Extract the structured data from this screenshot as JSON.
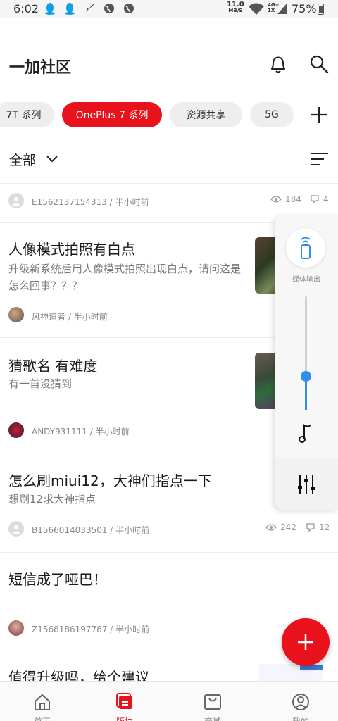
{
  "status_bar": {
    "time": "6:02",
    "net_speed_value": "11.0",
    "net_speed_unit": "MB/S",
    "net_type_top": "4G+",
    "net_type_bottom": "1X",
    "battery": "75%"
  },
  "header": {
    "title": "一加社区",
    "icons": [
      "bell-icon",
      "search-icon"
    ]
  },
  "tabs": [
    {
      "label": "7T 系列",
      "active": false
    },
    {
      "label": "OnePlus 7 系列",
      "active": true
    },
    {
      "label": "资源共享",
      "active": false
    },
    {
      "label": "5G",
      "active": false
    }
  ],
  "filter": {
    "label": "全部"
  },
  "posts": [
    {
      "title": "",
      "desc": "",
      "author": "E1562137154313",
      "time": "半小时前",
      "views": "184",
      "comments": "4"
    },
    {
      "title": "人像模式拍照有白点",
      "desc": "升级新系统后用人像模式拍照出现白点，请问这是怎么回事？？？",
      "author": "风神道者",
      "time": "半小时前"
    },
    {
      "title": "猜歌名 有难度",
      "desc": "有一首没猜到",
      "author": "ANDY931111",
      "time": "半小时前"
    },
    {
      "title": "怎么刷miui12，大神们指点一下",
      "desc": "想刷12求大神指点",
      "author": "B1566014033501",
      "time": "半小时前",
      "views": "242",
      "comments": "12"
    },
    {
      "title": "短信成了哑巴！",
      "desc": "",
      "author": "Z1568186197787",
      "time": "半小时前"
    },
    {
      "title": "值得升级吗，给个建议"
    }
  ],
  "meta_separator": " / ",
  "volume_panel": {
    "media_label": "媒体输出",
    "level": 0.3
  },
  "bottom_nav": [
    {
      "label": "首页",
      "icon": "home-icon",
      "active": false
    },
    {
      "label": "版块",
      "icon": "board-icon",
      "active": true
    },
    {
      "label": "商城",
      "icon": "shop-icon",
      "active": false
    },
    {
      "label": "我的",
      "icon": "profile-icon",
      "active": false
    }
  ],
  "colors": {
    "accent": "#e8121c",
    "slider": "#2f8ef0"
  }
}
